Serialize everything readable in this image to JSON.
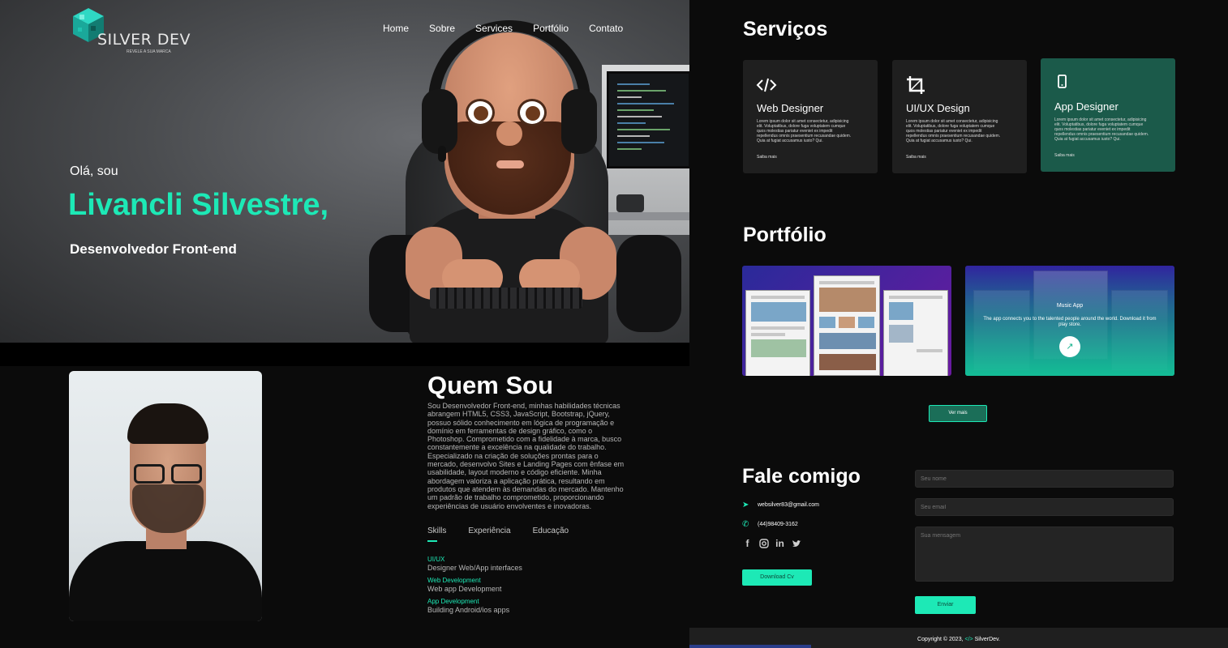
{
  "brand": {
    "name": "SILVER DEV",
    "tagline": "REVELE A SUA MARCA",
    "accent": "#1de9b6"
  },
  "nav": {
    "items": [
      "Home",
      "Sobre",
      "Services",
      "Portfólio",
      "Contato"
    ]
  },
  "hero": {
    "greeting": "Olá, sou",
    "name": "Livancli Silvestre,",
    "role": "Desenvolvedor Front-end"
  },
  "about": {
    "title": "Quem Sou",
    "text": "Sou Desenvolvedor Front-end, minhas habilidades técnicas abrangem HTML5, CSS3, JavaScript, Bootstrap, jQuery, possuo sólido conhecimento em lógica de programação e domínio em ferramentas de design gráfico, como o Photoshop. Comprometido com a fidelidade à marca, busco constantemente a excelência na qualidade do trabalho. Especializado na criação de soluções prontas para o mercado, desenvolvo Sites e Landing Pages com ênfase em usabilidade, layout moderno e código eficiente. Minha abordagem valoriza a aplicação prática, resultando em produtos que atendem às demandas do mercado. Mantenho um padrão de trabalho comprometido, proporcionando experiências de usuário envolventes e inovadoras.",
    "tabs": [
      "Skills",
      "Experiência",
      "Educação"
    ],
    "skills": [
      {
        "key": "UI/UX",
        "value": "Designer Web/App interfaces"
      },
      {
        "key": "Web Development",
        "value": "Web app Development"
      },
      {
        "key": "App Development",
        "value": "Building Android/ios apps"
      }
    ]
  },
  "services": {
    "title": "Serviços",
    "cards": [
      {
        "icon": "code-icon",
        "title": "Web Designer",
        "desc": "Lorem ipsum dolor sit amet consectetur, adipisicing elit. Voluptatibus, dolore fuga voluptatem cumque quos molestias pariatur eveniet ex impedit repellendus omnis praesentium recusandae quidem. Quia at fugiat accusamus iusto? Qui.",
        "more": "Saiba mais"
      },
      {
        "icon": "crop-icon",
        "title": "UI/UX Design",
        "desc": "Lorem ipsum dolor sit amet consectetur, adipisicing elit. Voluptatibus, dolore fuga voluptatem cumque quos molestias pariatur eveniet ex impedit repellendus omnis praesentium recusandae quidem. Quia at fugiat accusamus iusto? Qui.",
        "more": "Saiba mais"
      },
      {
        "icon": "mobile-icon",
        "title": "App Designer",
        "desc": "Lorem ipsum dolor sit amet consectetur, adipisicing elit. Voluptatibus, dolore fuga voluptatem cumque quos molestias pariatur eveniet ex impedit repellendus omnis praesentium recusandae quidem. Quia at fugiat accusamus iusto? Qui.",
        "more": "Saiba mais"
      }
    ]
  },
  "portfolio": {
    "title": "Portfólio",
    "item2": {
      "title": "Music App",
      "desc": "The app connects you to the talented people around the world. Download it from play store."
    },
    "more_button": "Ver mais"
  },
  "contact": {
    "title": "Fale comigo",
    "email": "websilver83@gmail.com",
    "phone": "(44)98409-3162",
    "cv_button": "Download Cv",
    "name_placeholder": "Seu nome",
    "email_placeholder": "Seu email",
    "message_placeholder": "Sua mensagem",
    "send_button": "Enviar"
  },
  "footer": {
    "copyright": "Copyright © 2023,",
    "brand": "SilverDev."
  }
}
